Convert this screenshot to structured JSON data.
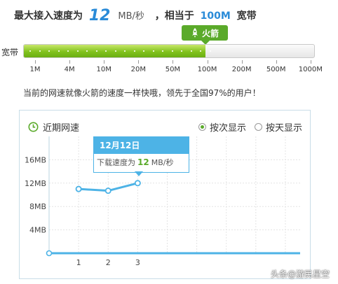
{
  "header": {
    "prefix": "最大接入速度为",
    "speed_value": "12",
    "speed_unit": "MB/秒",
    "middle": "，相当于",
    "bandwidth": "100M",
    "suffix": "宽带"
  },
  "rocket_tag": {
    "label": "火箭",
    "icon": "rocket-icon"
  },
  "bandwidth_bar": {
    "label": "宽带",
    "fill_fraction": 0.625,
    "ticks": [
      "1M",
      "4M",
      "10M",
      "20M",
      "50M",
      "100M",
      "200M",
      "500M",
      "1000M"
    ]
  },
  "message": "当前的网速就像火箭的速度一样快哦，领先于全国97%的用户！",
  "panel": {
    "title": "近期网速",
    "title_icon": "clock-icon",
    "radio_count": {
      "label": "按次显示",
      "checked": true
    },
    "radio_day": {
      "label": "按天显示",
      "checked": false
    }
  },
  "chart_data": {
    "type": "line",
    "x": [
      1,
      2,
      3
    ],
    "values": [
      11,
      10.7,
      12
    ],
    "xlabel": "",
    "ylabel": "",
    "y_ticks": [
      "4MB",
      "8MB",
      "12MB",
      "16MB"
    ],
    "x_ticks": [
      "1",
      "2",
      "3"
    ],
    "ylim": [
      0,
      20
    ],
    "xlim": [
      0,
      8.5
    ],
    "line_color": "#4db3e6",
    "grid": true
  },
  "tooltip": {
    "date": "12月12日",
    "prefix": "下载速度为",
    "value": "12",
    "unit": "MB/秒"
  },
  "watermark": "头条@游民星空",
  "colors": {
    "accent_blue": "#2a8bd8",
    "accent_green": "#5aaa2a"
  }
}
